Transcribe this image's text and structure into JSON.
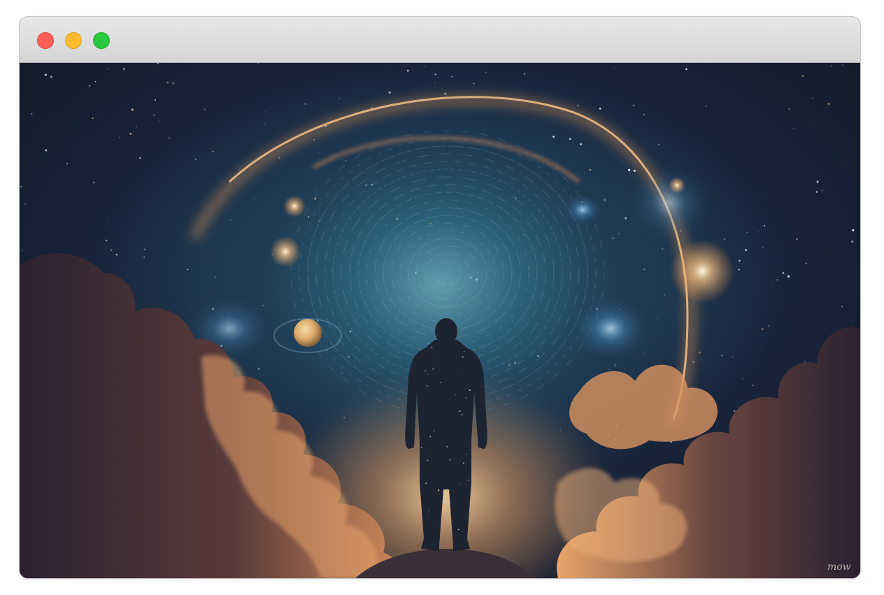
{
  "window": {
    "controls": [
      {
        "name": "close",
        "color": "#ff5f57",
        "border": "#e0443e"
      },
      {
        "name": "minimize",
        "color": "#febc2e",
        "border": "#dea123"
      },
      {
        "name": "zoom",
        "color": "#28c840",
        "border": "#1aab29"
      }
    ]
  },
  "artwork": {
    "description_icon": "cosmic-portal-artwork",
    "signature": "mow",
    "colors": {
      "sky_dark": "#141a28",
      "sky_mid": "#1e3a52",
      "nebula_teal": "#3d8fa8",
      "ring_glow": "#f3a25a",
      "cloud_warm": "#e39a62",
      "cloud_dark": "#2a2330",
      "figure": "#1f2433"
    }
  }
}
